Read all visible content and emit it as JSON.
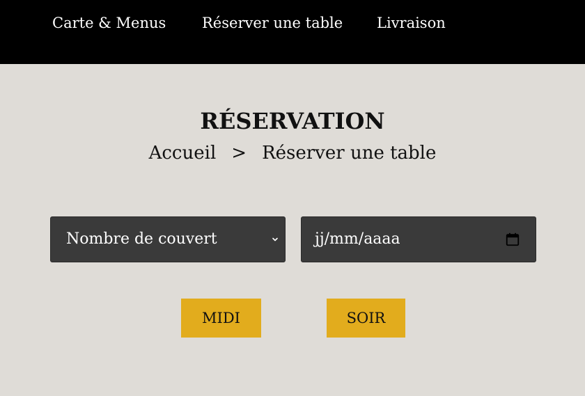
{
  "nav": {
    "items": [
      {
        "label": "Carte & Menus"
      },
      {
        "label": "Réserver une table"
      },
      {
        "label": "Livraison"
      }
    ]
  },
  "page": {
    "title": "RÉSERVATION"
  },
  "breadcrumb": {
    "home": "Accueil",
    "separator": ">",
    "current": "Réserver une table"
  },
  "form": {
    "guests_select": {
      "selected": "Nombre de couvert"
    },
    "date_input": {
      "placeholder": "jj/mm/aaaa"
    },
    "buttons": {
      "midi": "MIDI",
      "soir": "SOIR"
    }
  },
  "colors": {
    "nav_background": "#000000",
    "page_background": "#dfdcd7",
    "field_background": "#3a3a3a",
    "button_accent": "#e2ac1d"
  },
  "icons": {
    "select_arrow": "chevron-down-icon",
    "date_picker": "calendar-icon"
  }
}
